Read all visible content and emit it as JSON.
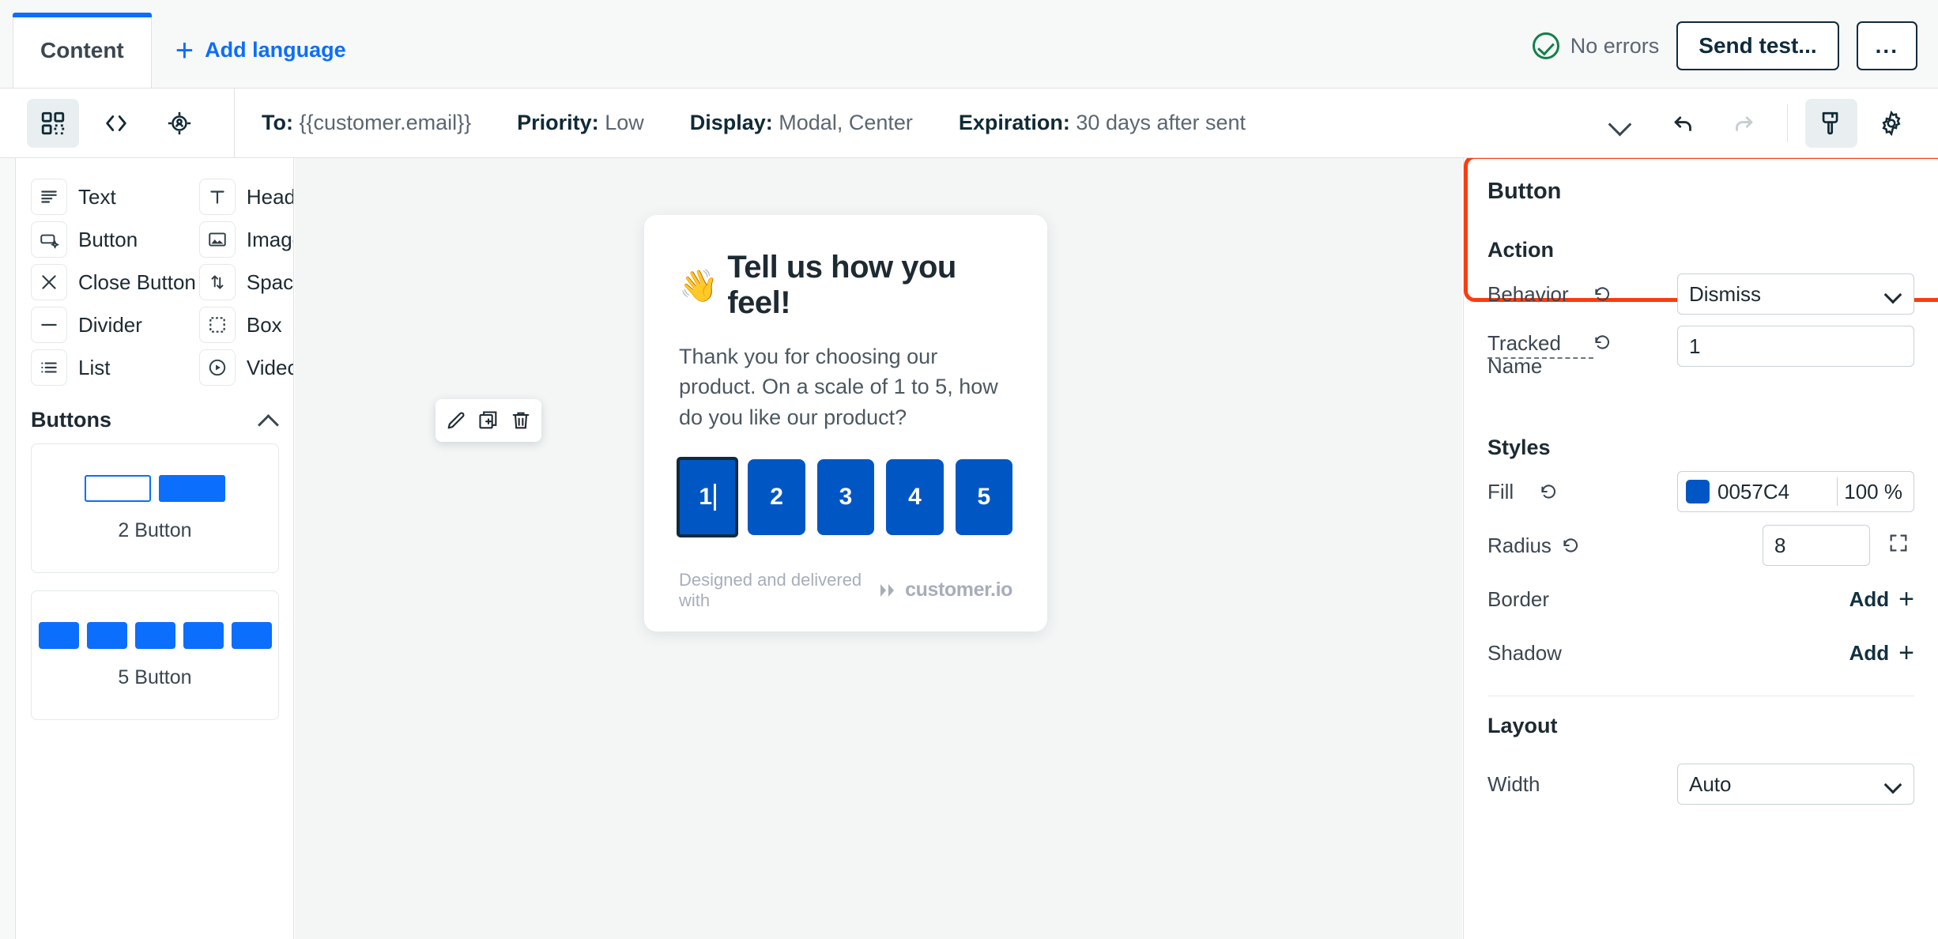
{
  "header": {
    "tab_label": "Content",
    "add_language_label": "Add language",
    "status_label": "No errors",
    "send_test_label": "Send test...",
    "more_label": "..."
  },
  "toolbar": {
    "icons": [
      {
        "name": "components-grid-icon",
        "active": true
      },
      {
        "name": "code-brackets-icon",
        "active": false
      },
      {
        "name": "target-person-icon",
        "active": false
      }
    ],
    "fields": [
      {
        "label": "To:",
        "value": "{{customer.email}}"
      },
      {
        "label": "Priority:",
        "value": "Low"
      },
      {
        "label": "Display:",
        "value": "Modal, Center"
      },
      {
        "label": "Expiration:",
        "value": "30 days after sent"
      }
    ],
    "right_icons": [
      {
        "name": "undo-icon",
        "active": false
      },
      {
        "name": "redo-icon",
        "active": false
      },
      {
        "name": "brush-icon",
        "active": true
      },
      {
        "name": "gear-icon",
        "active": false
      }
    ]
  },
  "left_panel": {
    "components": [
      {
        "label": "Text",
        "icon": "text-lines-icon"
      },
      {
        "label": "Heading",
        "icon": "heading-t-icon"
      },
      {
        "label": "Button",
        "icon": "button-icon"
      },
      {
        "label": "Image",
        "icon": "image-icon"
      },
      {
        "label": "Close Button",
        "icon": "close-x-icon"
      },
      {
        "label": "Spacer",
        "icon": "spacer-arrows-icon"
      },
      {
        "label": "Divider",
        "icon": "divider-line-icon"
      },
      {
        "label": "Box",
        "icon": "dashed-box-icon"
      },
      {
        "label": "List",
        "icon": "list-icon"
      },
      {
        "label": "Video",
        "icon": "play-circle-icon"
      }
    ],
    "buttons_section": {
      "title": "Buttons",
      "presets": [
        {
          "label": "2 Button",
          "kind": "two"
        },
        {
          "label": "5 Button",
          "kind": "five"
        }
      ]
    }
  },
  "canvas": {
    "modal": {
      "emoji": "👋",
      "title": "Tell us how you feel!",
      "body": "Thank you for choosing our product. On a scale of 1 to 5, how do you like our product?",
      "rating_buttons": [
        "1",
        "2",
        "3",
        "4",
        "5"
      ],
      "selected_rating_index": 0,
      "footer_text": "Designed and delivered with",
      "footer_brand": "customer.io"
    },
    "float_toolbar": [
      {
        "name": "edit-pencil-icon"
      },
      {
        "name": "duplicate-icon"
      },
      {
        "name": "delete-trash-icon"
      }
    ]
  },
  "right_panel": {
    "component_title": "Button",
    "action": {
      "title": "Action",
      "behavior_label": "Behavior",
      "behavior_value": "Dismiss",
      "tracked_name_label": "Tracked Name",
      "tracked_name_value": "1"
    },
    "styles": {
      "title": "Styles",
      "fill_label": "Fill",
      "fill_hex": "0057C4",
      "fill_color": "#0057C4",
      "fill_opacity": "100 %",
      "radius_label": "Radius",
      "radius_value": "8",
      "border_label": "Border",
      "border_action": "Add",
      "shadow_label": "Shadow",
      "shadow_action": "Add"
    },
    "layout": {
      "title": "Layout",
      "width_label": "Width",
      "width_value": "Auto"
    },
    "highlight_color": "#fa3c10"
  }
}
